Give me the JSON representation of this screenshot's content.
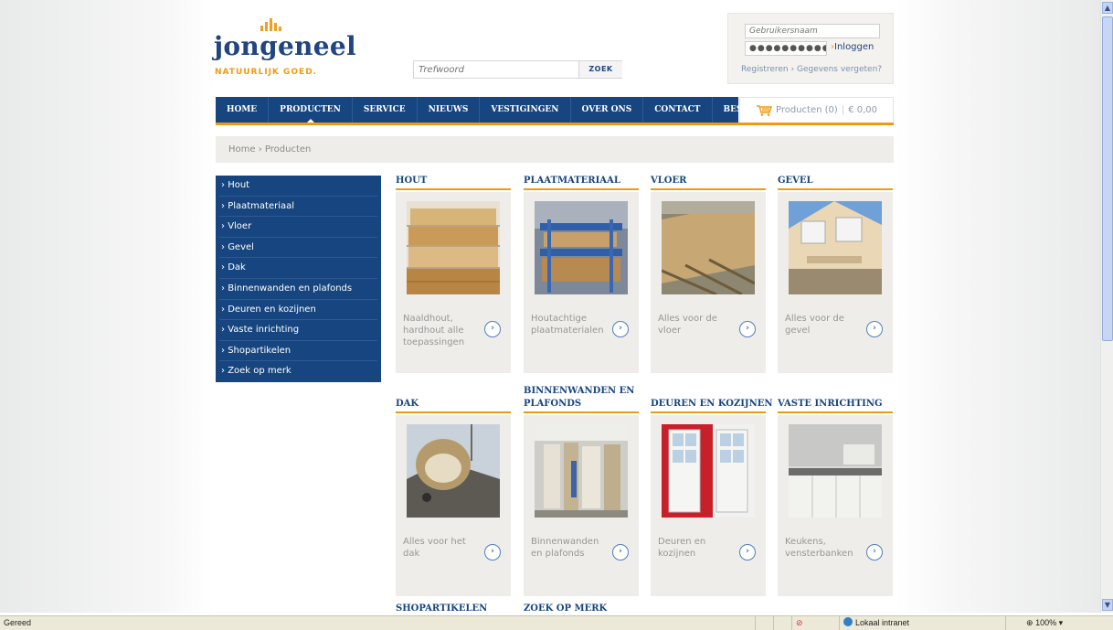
{
  "logo": {
    "name": "jongeneel",
    "tagline": "NATUURLIJK GOED."
  },
  "search": {
    "placeholder": "Trefwoord",
    "button": "ZOEK"
  },
  "login": {
    "username_placeholder": "Gebruikersnaam",
    "password_value": "●●●●●●●●●●",
    "login_label": "Inloggen",
    "register": "Registreren",
    "forgot": "Gegevens vergeten?",
    "separator": "›"
  },
  "nav": [
    "HOME",
    "PRODUCTEN",
    "SERVICE",
    "NIEUWS",
    "VESTIGINGEN",
    "OVER ONS",
    "CONTACT",
    "BESTELLEN"
  ],
  "nav_active": "PRODUCTEN",
  "cart": {
    "label": "Producten (0)",
    "total": "€ 0,00"
  },
  "breadcrumb": {
    "home": "Home",
    "separator": "›",
    "current": "Producten"
  },
  "sidebar": [
    "Hout",
    "Plaatmateriaal",
    "Vloer",
    "Gevel",
    "Dak",
    "Binnenwanden en plafonds",
    "Deuren en kozijnen",
    "Vaste inrichting",
    "Shopartikelen",
    "Zoek op merk"
  ],
  "products": [
    {
      "title": "HOUT",
      "caption": "Naaldhout, hardhout alle toepassingen",
      "icon": "stacked-lumber-photo"
    },
    {
      "title": "PLAATMATERIAAL",
      "caption": "Houtachtige plaatmaterialen",
      "icon": "panel-rack-photo"
    },
    {
      "title": "VLOER",
      "caption": "Alles voor de vloer",
      "icon": "floor-joists-photo"
    },
    {
      "title": "GEVEL",
      "caption": "Alles voor de gevel",
      "icon": "house-facade-photo"
    },
    {
      "title": "DAK",
      "caption": "Alles voor het dak",
      "icon": "roof-photo"
    },
    {
      "title": "BINNENWANDEN EN PLAFONDS",
      "caption": "Binnenwanden en plafonds",
      "icon": "interior-wall-photo"
    },
    {
      "title": "DEUREN EN KOZIJNEN",
      "caption": "Deuren en kozijnen",
      "icon": "glass-doors-photo"
    },
    {
      "title": "VASTE INRICHTING",
      "caption": "Keukens, vensterbanken",
      "icon": "kitchen-photo"
    },
    {
      "title": "SHOPARTIKELEN",
      "caption": "",
      "icon": ""
    },
    {
      "title": "ZOEK OP MERK",
      "caption": "",
      "icon": ""
    }
  ],
  "statusbar": {
    "status": "Gereed",
    "zone": "Lokaal intranet",
    "zoom": "100%"
  },
  "colors": {
    "navy": "#17457f",
    "orange": "#f09a13",
    "card_bg": "#efedea"
  }
}
